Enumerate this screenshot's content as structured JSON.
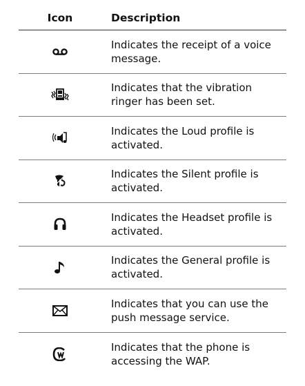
{
  "table": {
    "headers": {
      "icon": "Icon",
      "description": "Description"
    },
    "rows": [
      {
        "icon": "voicemail-icon",
        "description": "Indicates the receipt of a voice message."
      },
      {
        "icon": "vibration-icon",
        "description": "Indicates that the vibration ringer has been set."
      },
      {
        "icon": "loud-profile-icon",
        "description": "Indicates the Loud profile is activated."
      },
      {
        "icon": "silent-profile-icon",
        "description": "Indicates the Silent profile is activated."
      },
      {
        "icon": "headset-icon",
        "description": "Indicates the Headset profile is activated."
      },
      {
        "icon": "music-note-icon",
        "description": "Indicates the General profile is activated."
      },
      {
        "icon": "envelope-icon",
        "description": "Indicates that you can use the push message service."
      },
      {
        "icon": "wap-icon",
        "description": "Indicates that the phone is accessing the WAP."
      }
    ]
  }
}
